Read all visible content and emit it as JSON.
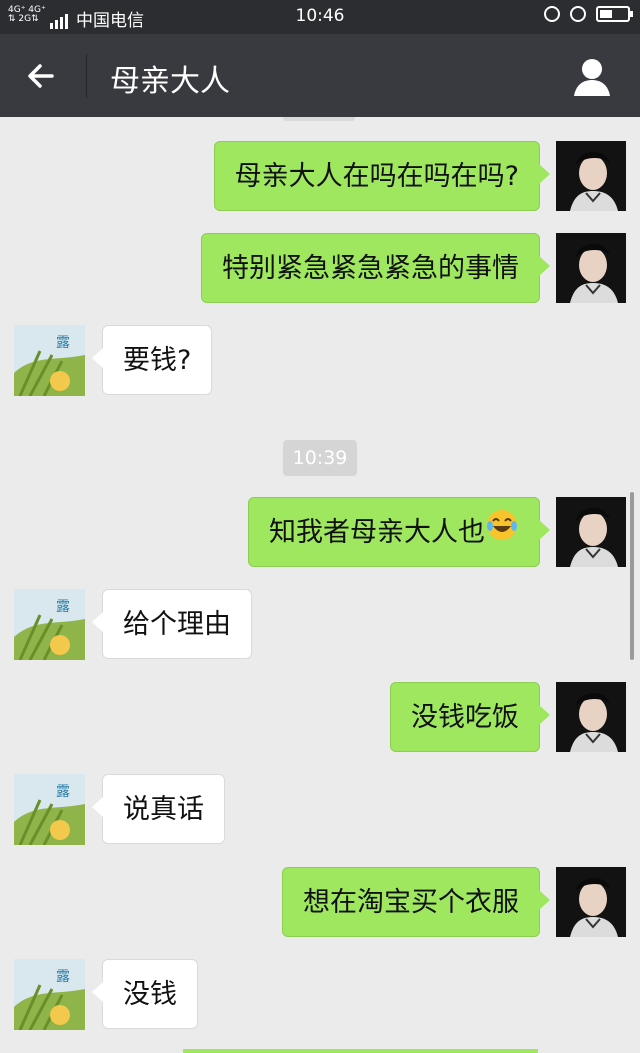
{
  "status_bar": {
    "network_top": "4G⁺ 4G⁺",
    "network_bottom": "⇅ 2G⇅",
    "carrier": "中国电信",
    "time": "10:46"
  },
  "nav": {
    "title": "母亲大人"
  },
  "messages": [
    {
      "sender": "me",
      "text": "母亲大人在吗在吗在吗?"
    },
    {
      "sender": "me",
      "text": "特别紧急紧急紧急的事情"
    },
    {
      "sender": "mom",
      "text": "要钱?"
    },
    {
      "sender": "me",
      "text": "知我者母亲大人也",
      "emoji": "tears-of-joy"
    },
    {
      "sender": "mom",
      "text": "给个理由"
    },
    {
      "sender": "me",
      "text": "没钱吃饭"
    },
    {
      "sender": "mom",
      "text": "说真话"
    },
    {
      "sender": "me",
      "text": "想在淘宝买个衣服"
    },
    {
      "sender": "mom",
      "text": "没钱"
    }
  ],
  "timestamp": "10:39",
  "avatar_mom_label": "露",
  "colors": {
    "nav_bg": "#393a3f",
    "status_bg": "#2b2d31",
    "chat_bg": "#ebebeb",
    "my_bubble": "#9fe75e",
    "their_bubble": "#ffffff"
  }
}
